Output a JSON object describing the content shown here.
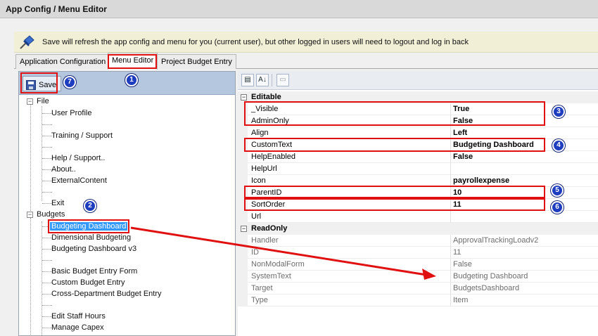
{
  "window": {
    "title": "App Config / Menu Editor"
  },
  "info_bar": {
    "icon": "pushpin-icon",
    "message": "Save will refresh the app config and menu for you (current user), but other logged in users will need to logout and log in back"
  },
  "tabs": [
    {
      "label": "Application Configuration",
      "active": false
    },
    {
      "label": "Menu Editor",
      "active": true
    },
    {
      "label": "Project Budget Entry",
      "active": false
    }
  ],
  "toolbar": {
    "save_label": "Save"
  },
  "tree": {
    "file": {
      "label": "File",
      "items": [
        "User Profile",
        "Training / Support",
        "Help / Support..",
        "About..",
        "ExternalContent",
        "Exit"
      ]
    },
    "budgets": {
      "label": "Budgets",
      "items": [
        "Budgeting Dashboard",
        "Dimensional Budgeting",
        "Budgeting Dashboard v3",
        "Basic Budget Entry Form",
        "Custom Budget Entry",
        "Cross-Department Budget Entry",
        "Edit Staff Hours",
        "Manage Capex"
      ]
    }
  },
  "property_grid": {
    "categories": {
      "editable": "Editable",
      "readonly": "ReadOnly"
    },
    "editable": [
      {
        "name": "_Visible",
        "value": "True"
      },
      {
        "name": "AdminOnly",
        "value": "False"
      },
      {
        "name": "Align",
        "value": "Left"
      },
      {
        "name": "CustomText",
        "value": "Budgeting Dashboard"
      },
      {
        "name": "HelpEnabled",
        "value": "False"
      },
      {
        "name": "HelpUrl",
        "value": ""
      },
      {
        "name": "Icon",
        "value": "payrollexpense"
      },
      {
        "name": "ParentID",
        "value": "10"
      },
      {
        "name": "SortOrder",
        "value": "11"
      },
      {
        "name": "Url",
        "value": ""
      }
    ],
    "readonly": [
      {
        "name": "Handler",
        "value": "ApprovalTrackingLoadv2"
      },
      {
        "name": "ID",
        "value": "11"
      },
      {
        "name": "NonModalForm",
        "value": "False"
      },
      {
        "name": "SystemText",
        "value": "Budgeting Dashboard"
      },
      {
        "name": "Target",
        "value": "BudgetsDashboard"
      },
      {
        "name": "Type",
        "value": "Item"
      }
    ]
  },
  "callouts": [
    "1",
    "2",
    "3",
    "4",
    "5",
    "6",
    "7"
  ],
  "colors": {
    "highlight": "#e01010",
    "badge": "#1f3dbf",
    "toolbar": "#b5c6df",
    "info_bar": "#f1efd6",
    "selection": "#3399ff"
  }
}
